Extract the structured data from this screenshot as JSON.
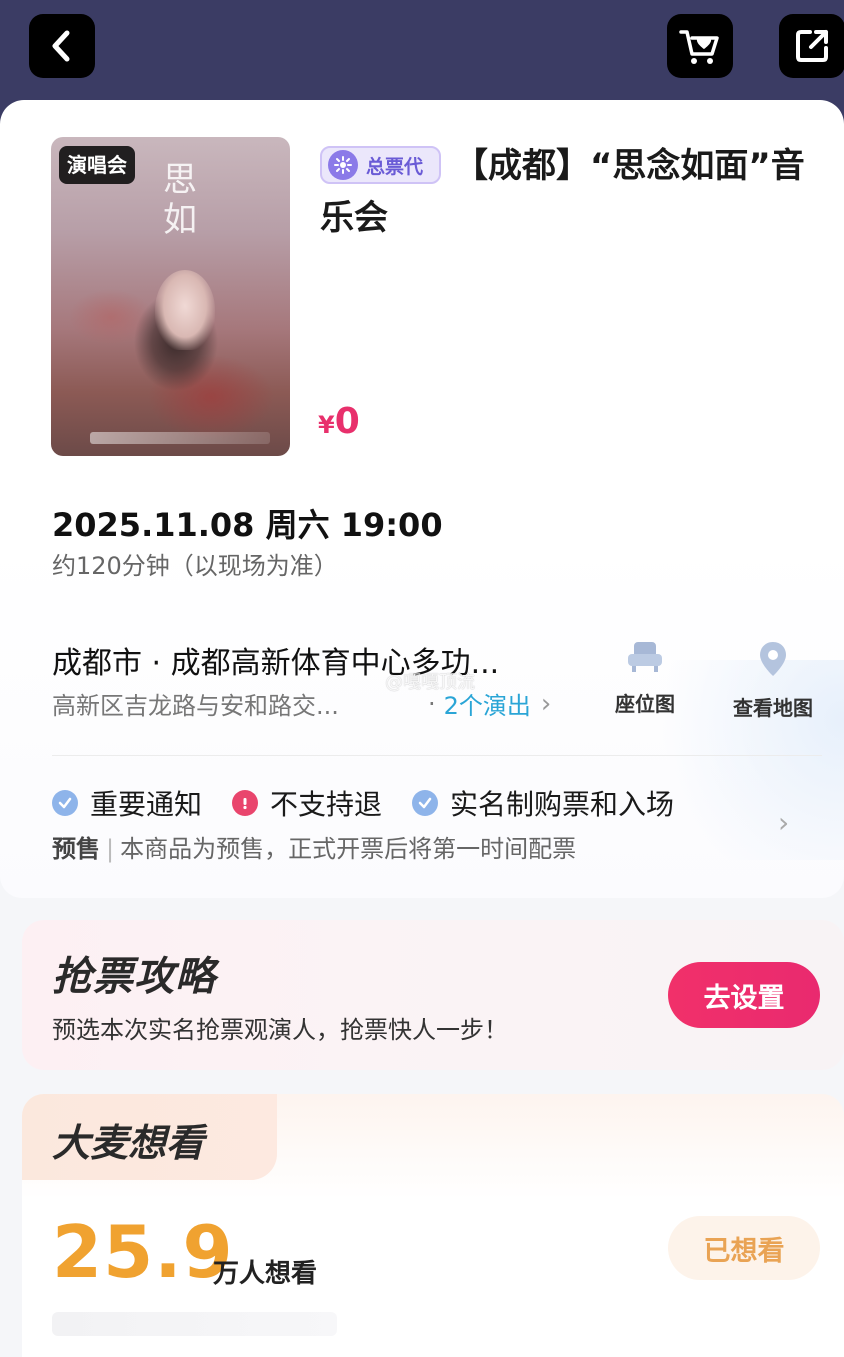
{
  "nav": {
    "back_icon": "chevron-left-icon",
    "cart_icon": "cart-heart-icon",
    "share_icon": "share-icon"
  },
  "event": {
    "category_tag": "演唱会",
    "agent_badge": "总票代",
    "title": "【成都】“思念如面”音乐会",
    "price_symbol": "¥",
    "price_value": "0",
    "datetime": "2025.11.08 周六 19:00",
    "duration": "约120分钟（以现场为准）",
    "venue_name": "成都市 · 成都高新体育中心多功...",
    "venue_address": "高新区吉龙路与安和路交...",
    "shows_separator": "·",
    "shows_link": "2个演出",
    "seat_map_label": "座位图",
    "view_map_label": "查看地图",
    "watermark": "@嘎嘎顶流"
  },
  "notices": {
    "items": [
      {
        "label": "重要通知",
        "icon": "check-badge-icon"
      },
      {
        "label": "不支持退",
        "icon": "alert-icon"
      },
      {
        "label": "实名制购票和入场",
        "icon": "check-badge-icon"
      }
    ],
    "presale_tag": "预售",
    "presale_separator": "|",
    "presale_text": "本商品为预售，正式开票后将第一时间配票"
  },
  "strategy": {
    "title": "抢票攻略",
    "description": "预选本次实名抢票观演人，抢票快人一步！",
    "button_label": "去设置"
  },
  "want": {
    "title": "大麦想看",
    "count": "25.9",
    "unit": "万人想看",
    "button_label": "已想看"
  },
  "colors": {
    "header_bg": "#3b3c64",
    "price": "#e8306c",
    "link": "#2aa5d6",
    "primary_button": "#f1306a",
    "want_count": "#f0a230",
    "agent_badge": "#6a5bd6"
  }
}
